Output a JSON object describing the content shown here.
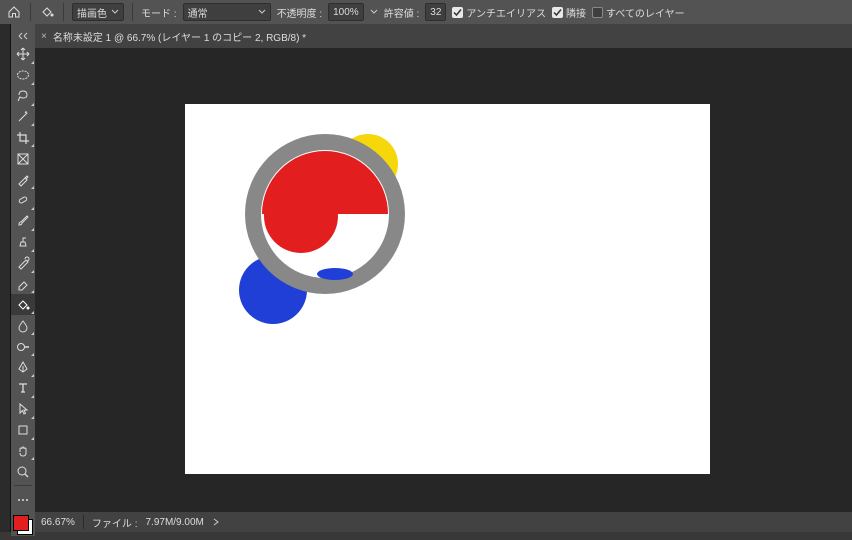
{
  "topbar": {
    "fill_mode": "描画色",
    "mode_label": "モード :",
    "mode_value": "通常",
    "opacity_label": "不透明度 :",
    "opacity_value": "100%",
    "tolerance_label": "許容値 :",
    "tolerance_value": "32",
    "antialias": "アンチエイリアス",
    "contiguous": "隣接",
    "all_layers": "すべてのレイヤー"
  },
  "tab": {
    "title": "名称未設定 1 @ 66.7% (レイヤー 1 のコピー 2, RGB/8) *"
  },
  "status": {
    "zoom": "66.67%",
    "file_label": "ファイル :",
    "file_value": "7.97M/9.00M"
  }
}
